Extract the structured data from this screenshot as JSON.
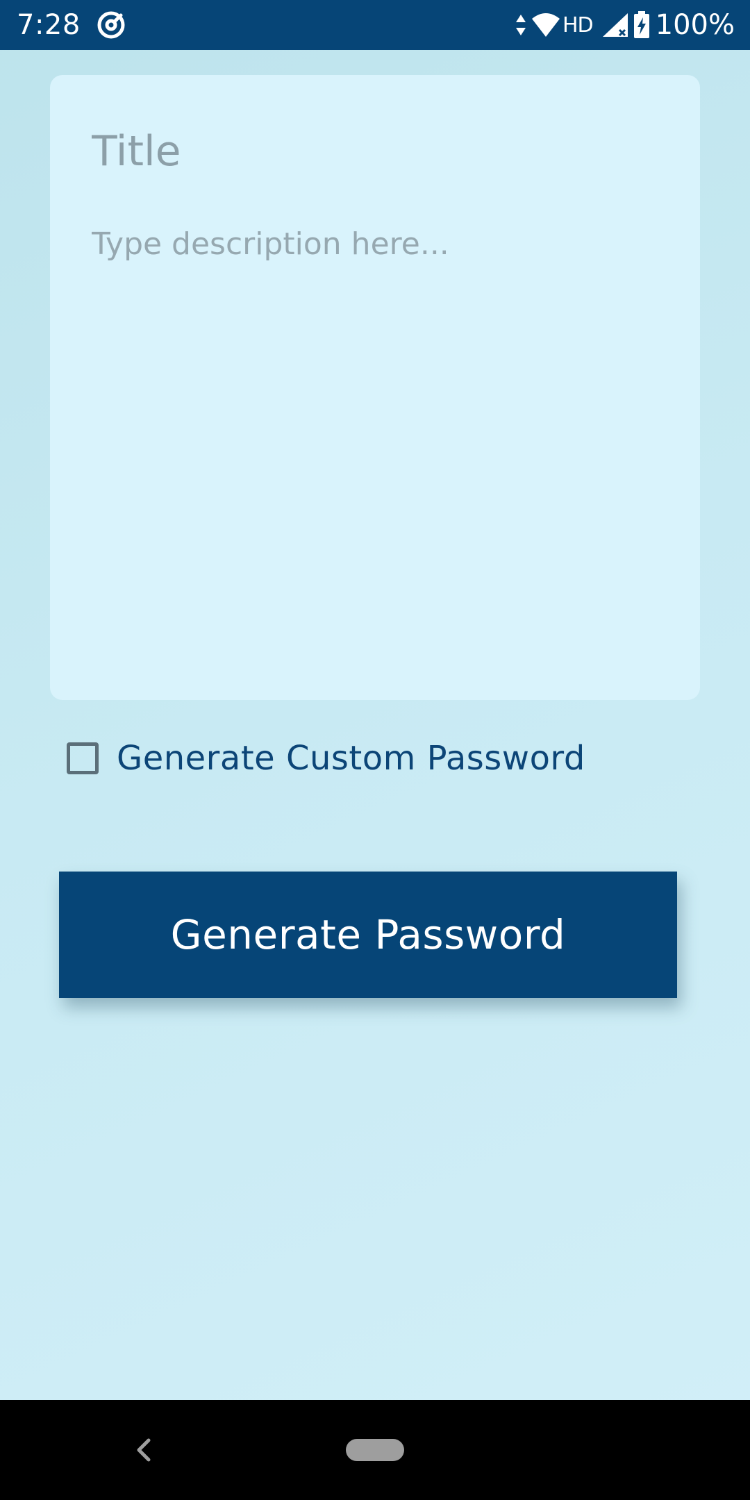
{
  "status_bar": {
    "time": "7:28",
    "network_label": "HD",
    "battery_percent": "100%",
    "icons": [
      "at-sign-icon",
      "data-arrows-icon",
      "wifi-icon",
      "signal-icon",
      "battery-charging-icon"
    ]
  },
  "note": {
    "title_placeholder": "Title",
    "title_value": "",
    "description_placeholder": "Type description here...",
    "description_value": ""
  },
  "custom_password": {
    "label": "Generate Custom Password",
    "checked": false
  },
  "generate_button": {
    "label": "Generate Password"
  },
  "nav_bar": {
    "icons": [
      "back-icon",
      "home-pill-icon"
    ]
  },
  "colors": {
    "primary": "#064577",
    "card": "#d9f3fc",
    "background": "#c8eaf3",
    "placeholder": "#8c9fa8"
  }
}
